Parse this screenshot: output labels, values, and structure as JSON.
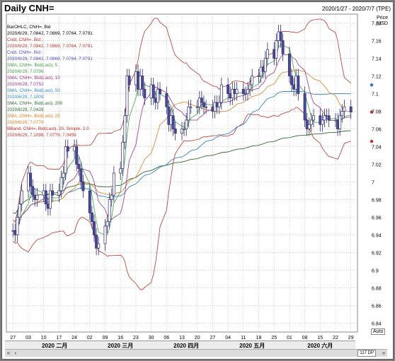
{
  "title": "Daily CNH=",
  "date_range": "2020/1/27 - 2020/7/7 (TPE)",
  "price_axis_label": [
    "Price",
    "/USD"
  ],
  "auto_label": "Auto",
  "zoom_label": "117 DP",
  "months": [
    {
      "label": "2020 二月",
      "day": "2020-02-15"
    },
    {
      "label": "2020 三月",
      "day": "2020-03-16"
    },
    {
      "label": "2020 四月",
      "day": "2020-04-15"
    },
    {
      "label": "2020 五月",
      "day": "2020-05-15"
    },
    {
      "label": "2020 六月",
      "day": "2020-06-15"
    }
  ],
  "legend": [
    {
      "text": "BarOHLC, CNH=, Bid",
      "color": "#000000"
    },
    {
      "text": "2020/6/29, 7.0842, 7.0869, 7.0764, 7.0791",
      "color": "#000000"
    },
    {
      "text": "Cndl, CNH=, Bid ;",
      "color": "#c0302a"
    },
    {
      "text": "2020/6/29, 7.0842, 7.0869, 7.0764, 7.0791",
      "color": "#c0302a"
    },
    {
      "text": "Cndl, CNH=, Bid ;",
      "color": "#4a4ac8"
    },
    {
      "text": "2020/6/29, 7.0842, 7.0869, 7.0764, 7.0791",
      "color": "#4a4ac8"
    },
    {
      "text": "SMA, CNH=, Bid(Last), 5",
      "color": "#3aa048"
    },
    {
      "text": "2020/6/29, 7.0796",
      "color": "#3aa048"
    },
    {
      "text": "SMA, CNH=, Bid(Last), 10",
      "color": "#9b2f86"
    },
    {
      "text": "2020/6/29, 7.0752",
      "color": "#9b2f86"
    },
    {
      "text": "SMA, CNH=, Bid(Last), 50",
      "color": "#2f86c8"
    },
    {
      "text": "2020/6/29, 7.1009",
      "color": "#2f86c8"
    },
    {
      "text": "SMA, CNH=, Bid(Last), 200",
      "color": "#2d6b2d"
    },
    {
      "text": "2020/6/29, 7.0428",
      "color": "#2d6b2d"
    },
    {
      "text": "SMA, CNH=, Bid(Last), 20",
      "color": "#e07b20"
    },
    {
      "text": "2020/6/29, 7.0779",
      "color": "#e07b20"
    },
    {
      "text": "BBand, CNH=, Bid(Last), 20, Simple, 2.0",
      "color": "#c0302a"
    },
    {
      "text": "2020/6/29, 7.1098, 7.0779, 7.0459",
      "color": "#c0302a"
    }
  ],
  "chart_data": {
    "type": "candlestick",
    "title": "Daily CNH=",
    "ylabel": "Price /USD",
    "ylim": [
      6.83,
      7.19
    ],
    "y_ticks": [
      6.84,
      6.86,
      6.88,
      6.9,
      6.92,
      6.94,
      6.96,
      6.98,
      7,
      7.02,
      7.04,
      7.06,
      7.08,
      7.1,
      7.12,
      7.14,
      7.16,
      7.18
    ],
    "x_tick_labels": [
      "27",
      "03",
      "10",
      "17",
      "24",
      "02",
      "09",
      "16",
      "23",
      "30",
      "06",
      "13",
      "20",
      "27",
      "04",
      "11",
      "18",
      "25",
      "01",
      "08",
      "15",
      "22",
      "29"
    ],
    "x_tick_dates": [
      "2020-01-27",
      "2020-02-03",
      "2020-02-10",
      "2020-02-17",
      "2020-02-24",
      "2020-03-02",
      "2020-03-09",
      "2020-03-16",
      "2020-03-23",
      "2020-03-30",
      "2020-04-06",
      "2020-04-13",
      "2020-04-20",
      "2020-04-27",
      "2020-05-04",
      "2020-05-11",
      "2020-05-18",
      "2020-05-25",
      "2020-06-01",
      "2020-06-08",
      "2020-06-15",
      "2020-06-22",
      "2020-06-29"
    ],
    "x_range": [
      "2020-01-24",
      "2020-07-02"
    ],
    "grid": true,
    "close_series": [
      [
        "2020-01-27",
        6.945
      ],
      [
        "2020-01-28",
        6.94
      ],
      [
        "2020-01-29",
        6.96
      ],
      [
        "2020-01-30",
        6.975
      ],
      [
        "2020-01-31",
        6.99
      ],
      [
        "2020-02-03",
        7.01
      ],
      [
        "2020-02-04",
        6.995
      ],
      [
        "2020-02-05",
        6.985
      ],
      [
        "2020-02-06",
        6.98
      ],
      [
        "2020-02-07",
        6.985
      ],
      [
        "2020-02-10",
        6.99
      ],
      [
        "2020-02-11",
        6.975
      ],
      [
        "2020-02-12",
        6.97
      ],
      [
        "2020-02-13",
        6.99
      ],
      [
        "2020-02-14",
        6.985
      ],
      [
        "2020-02-17",
        6.99
      ],
      [
        "2020-02-18",
        7.005
      ],
      [
        "2020-02-19",
        7.01
      ],
      [
        "2020-02-20",
        7.04
      ],
      [
        "2020-02-21",
        7.035
      ],
      [
        "2020-02-24",
        7.04
      ],
      [
        "2020-02-25",
        7.02
      ],
      [
        "2020-02-26",
        7.015
      ],
      [
        "2020-02-27",
        7.0
      ],
      [
        "2020-02-28",
        6.99
      ],
      [
        "2020-03-02",
        6.965
      ],
      [
        "2020-03-03",
        6.955
      ],
      [
        "2020-03-04",
        6.94
      ],
      [
        "2020-03-05",
        6.925
      ],
      [
        "2020-03-06",
        6.93
      ],
      [
        "2020-03-09",
        6.95
      ],
      [
        "2020-03-10",
        6.955
      ],
      [
        "2020-03-11",
        6.98
      ],
      [
        "2020-03-12",
        6.985
      ],
      [
        "2020-03-13",
        7.01
      ],
      [
        "2020-03-16",
        7.015
      ],
      [
        "2020-03-17",
        7.045
      ],
      [
        "2020-03-18",
        7.075
      ],
      [
        "2020-03-19",
        7.12
      ],
      [
        "2020-03-20",
        7.11
      ],
      [
        "2020-03-23",
        7.125
      ],
      [
        "2020-03-24",
        7.105
      ],
      [
        "2020-03-25",
        7.12
      ],
      [
        "2020-03-26",
        7.105
      ],
      [
        "2020-03-27",
        7.095
      ],
      [
        "2020-03-30",
        7.11
      ],
      [
        "2020-03-31",
        7.095
      ],
      [
        "2020-04-01",
        7.09
      ],
      [
        "2020-04-02",
        7.105
      ],
      [
        "2020-04-03",
        7.1
      ],
      [
        "2020-04-06",
        7.085
      ],
      [
        "2020-04-07",
        7.065
      ],
      [
        "2020-04-08",
        7.075
      ],
      [
        "2020-04-09",
        7.06
      ],
      [
        "2020-04-10",
        7.055
      ],
      [
        "2020-04-13",
        7.06
      ],
      [
        "2020-04-14",
        7.06
      ],
      [
        "2020-04-15",
        7.07
      ],
      [
        "2020-04-16",
        7.085
      ],
      [
        "2020-04-17",
        7.085
      ],
      [
        "2020-04-20",
        7.085
      ],
      [
        "2020-04-21",
        7.095
      ],
      [
        "2020-04-22",
        7.09
      ],
      [
        "2020-04-23",
        7.085
      ],
      [
        "2020-04-24",
        7.085
      ],
      [
        "2020-04-27",
        7.08
      ],
      [
        "2020-04-28",
        7.09
      ],
      [
        "2020-04-29",
        7.085
      ],
      [
        "2020-04-30",
        7.09
      ],
      [
        "2020-05-01",
        7.11
      ],
      [
        "2020-05-04",
        7.1
      ],
      [
        "2020-05-05",
        7.095
      ],
      [
        "2020-05-06",
        7.105
      ],
      [
        "2020-05-07",
        7.1
      ],
      [
        "2020-05-08",
        7.105
      ],
      [
        "2020-05-11",
        7.1
      ],
      [
        "2020-05-12",
        7.1
      ],
      [
        "2020-05-13",
        7.105
      ],
      [
        "2020-05-14",
        7.11
      ],
      [
        "2020-05-15",
        7.12
      ],
      [
        "2020-05-18",
        7.12
      ],
      [
        "2020-05-19",
        7.13
      ],
      [
        "2020-05-20",
        7.125
      ],
      [
        "2020-05-21",
        7.14
      ],
      [
        "2020-05-22",
        7.15
      ],
      [
        "2020-05-25",
        7.14
      ],
      [
        "2020-05-26",
        7.16
      ],
      [
        "2020-05-27",
        7.17
      ],
      [
        "2020-05-28",
        7.16
      ],
      [
        "2020-05-29",
        7.145
      ],
      [
        "2020-06-01",
        7.12
      ],
      [
        "2020-06-02",
        7.11
      ],
      [
        "2020-06-03",
        7.105
      ],
      [
        "2020-06-04",
        7.12
      ],
      [
        "2020-06-05",
        7.1
      ],
      [
        "2020-06-08",
        7.07
      ],
      [
        "2020-06-09",
        7.06
      ],
      [
        "2020-06-10",
        7.065
      ],
      [
        "2020-06-11",
        7.07
      ],
      [
        "2020-06-12",
        7.075
      ],
      [
        "2020-06-15",
        7.065
      ],
      [
        "2020-06-16",
        7.07
      ],
      [
        "2020-06-17",
        7.075
      ],
      [
        "2020-06-18",
        7.075
      ],
      [
        "2020-06-19",
        7.07
      ],
      [
        "2020-06-22",
        7.07
      ],
      [
        "2020-06-23",
        7.06
      ],
      [
        "2020-06-24",
        7.075
      ],
      [
        "2020-06-25",
        7.08
      ],
      [
        "2020-06-26",
        7.085
      ],
      [
        "2020-06-29",
        7.0791
      ]
    ],
    "last_candle": {
      "date": "2020-06-29",
      "open": 7.0842,
      "high": 7.0869,
      "low": 7.0764,
      "close": 7.0791
    },
    "series": [
      {
        "name": "SMA, CNH=, Bid(Last), 5",
        "last": 7.0796,
        "color": "#3aa048"
      },
      {
        "name": "SMA, CNH=, Bid(Last), 10",
        "last": 7.0752,
        "color": "#9b2f86"
      },
      {
        "name": "SMA, CNH=, Bid(Last), 50",
        "last": 7.1009,
        "color": "#2f86c8"
      },
      {
        "name": "SMA, CNH=, Bid(Last), 200",
        "last": 7.0428,
        "color": "#2d6b2d"
      },
      {
        "name": "SMA, CNH=, Bid(Last), 20",
        "last": 7.0779,
        "color": "#e07b20"
      },
      {
        "name": "BBand, CNH=, Bid(Last), 20, Simple, 2.0",
        "upper": 7.1098,
        "middle": 7.0779,
        "lower": 7.0459,
        "color": "#c0302a"
      }
    ]
  }
}
